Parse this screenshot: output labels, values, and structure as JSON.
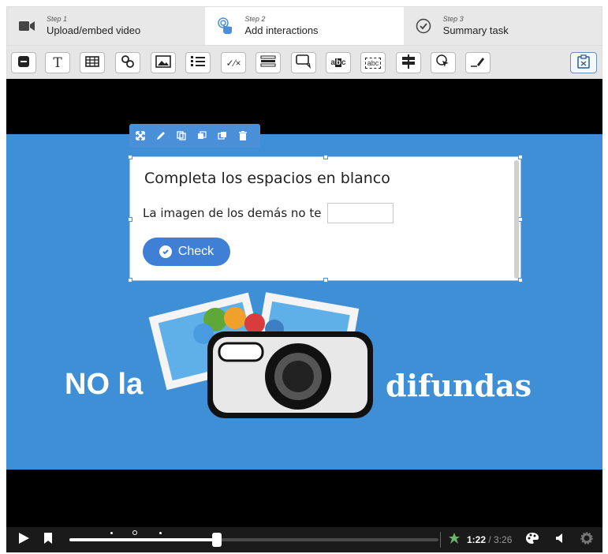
{
  "steps": [
    {
      "small": "Step 1",
      "label": "Upload/embed video",
      "icon": "video-camera-icon"
    },
    {
      "small": "Step 2",
      "label": "Add interactions",
      "icon": "tap-hand-icon"
    },
    {
      "small": "Step 3",
      "label": "Summary task",
      "icon": "check-circle-icon"
    }
  ],
  "toolbar": {
    "tools": [
      "label-tool",
      "text-tool",
      "table-tool",
      "link-tool",
      "image-tool",
      "statements-tool",
      "single-choice-tool",
      "multiple-choice-tool",
      "free-text-tool",
      "fill-blanks-tool",
      "drag-text-tool",
      "crossroads-tool",
      "navigation-hotspot-tool",
      "mark-words-tool"
    ],
    "clipboard_tool": "paste-tool"
  },
  "slide": {
    "left_text": "NO la",
    "right_text": "difundas"
  },
  "interaction": {
    "title": "Completa los espacios en blanco",
    "question": "La imagen de los demás no te",
    "blank_value": "",
    "check_label": "Check"
  },
  "player": {
    "current_time": "1:22",
    "total_time": "3:26",
    "progress": 0.4
  },
  "colors": {
    "accent": "#3f7fd6",
    "slide_bg": "#3f8fd6",
    "popup_toolbar": "#4a90d9"
  }
}
